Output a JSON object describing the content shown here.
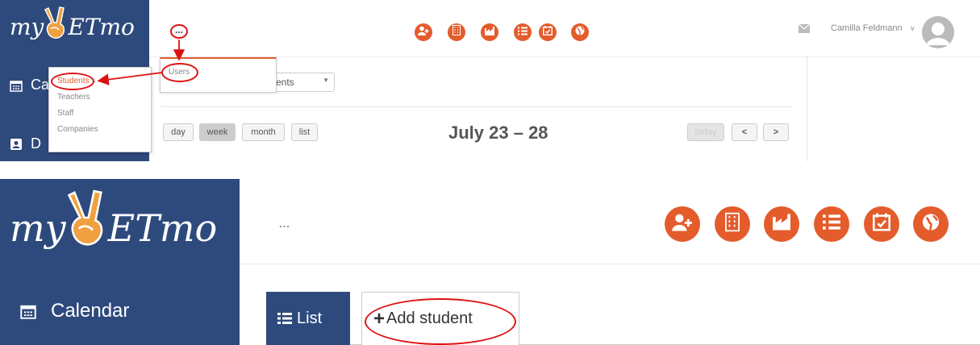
{
  "top": {
    "logo": {
      "text_before": "my",
      "text_after": "ETmo"
    },
    "sidebar": [
      {
        "label": "Ca",
        "icon": "calendar-icon"
      },
      {
        "label": "D",
        "icon": "address-book-icon"
      }
    ],
    "more_menu_label": "...",
    "users_menu": {
      "item": "Users"
    },
    "main_menu": [
      "Students",
      "Teachers",
      "Staff",
      "Companies"
    ],
    "select": {
      "value": "ents"
    },
    "view_buttons": {
      "day": "day",
      "week": "week",
      "month": "month",
      "list": "list"
    },
    "calendar_title": "July 23 – 28",
    "nav_buttons": {
      "today": "today",
      "prev": "<",
      "next": ">"
    },
    "header_icons": [
      "add-user-icon",
      "building-icon",
      "factory-icon",
      "list-icon",
      "calendar-check-icon",
      "globe-icon"
    ],
    "user": {
      "name": "Camilla Feldmann",
      "caret": "v"
    }
  },
  "bottom": {
    "logo": {
      "text_before": "my",
      "text_after": "ETmo"
    },
    "sidebar": [
      {
        "label": "Calendar",
        "icon": "calendar-icon"
      }
    ],
    "more_menu_label": "...",
    "header_icons": [
      "add-user-icon",
      "building-icon",
      "factory-icon",
      "list-icon",
      "calendar-check-icon",
      "globe-icon"
    ],
    "tabs": {
      "list": "List",
      "add_plus": "+",
      "add": "Add student"
    }
  },
  "colors": {
    "brand_blue": "#2e4a7d",
    "accent_orange": "#e45c2c",
    "annotation_red": "#dd1111"
  }
}
